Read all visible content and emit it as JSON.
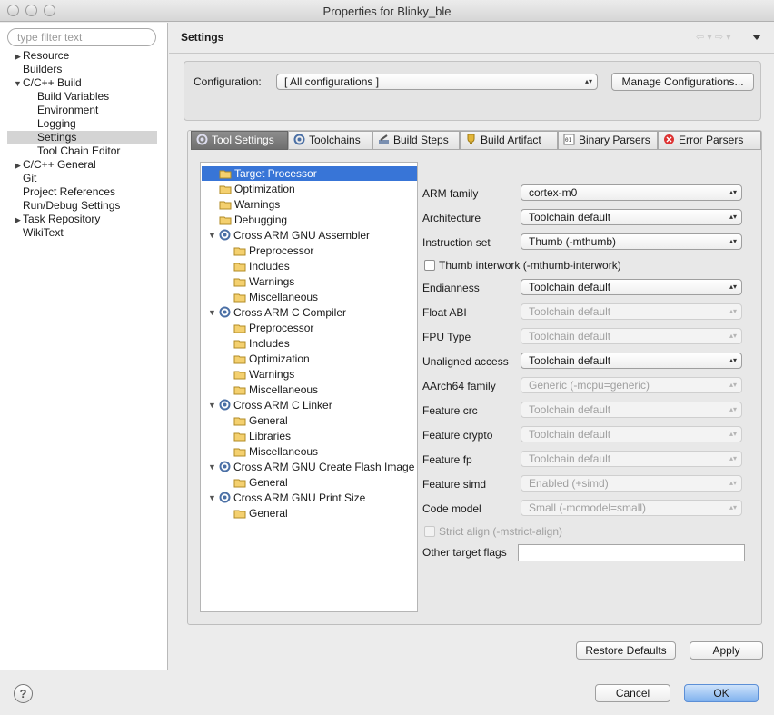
{
  "window": {
    "title": "Properties for Blinky_ble"
  },
  "filter": {
    "placeholder": "type filter text"
  },
  "nav": {
    "items": [
      {
        "label": "Resource"
      },
      {
        "label": "Builders"
      },
      {
        "label": "C/C++ Build"
      },
      {
        "label": "Build Variables"
      },
      {
        "label": "Environment"
      },
      {
        "label": "Logging"
      },
      {
        "label": "Settings"
      },
      {
        "label": "Tool Chain Editor"
      },
      {
        "label": "C/C++ General"
      },
      {
        "label": "Git"
      },
      {
        "label": "Project References"
      },
      {
        "label": "Run/Debug Settings"
      },
      {
        "label": "Task Repository"
      },
      {
        "label": "WikiText"
      }
    ]
  },
  "page": {
    "heading": "Settings",
    "nav_icons": "⇦ ▾  ⇨ ▾"
  },
  "config": {
    "label": "Configuration:",
    "value": "[ All configurations ]",
    "manage_label": "Manage Configurations..."
  },
  "tabs": [
    {
      "label": "Tool Settings",
      "icon": "tool-settings-icon"
    },
    {
      "label": "Toolchains",
      "icon": "toolchains-icon"
    },
    {
      "label": "Build Steps",
      "icon": "build-steps-icon"
    },
    {
      "label": "Build Artifact",
      "icon": "build-artifact-icon"
    },
    {
      "label": "Binary Parsers",
      "icon": "binary-parsers-icon"
    },
    {
      "label": "Error Parsers",
      "icon": "error-parsers-icon"
    }
  ],
  "tools": [
    {
      "label": "Target Processor"
    },
    {
      "label": "Optimization"
    },
    {
      "label": "Warnings"
    },
    {
      "label": "Debugging"
    },
    {
      "label": "Cross ARM GNU Assembler"
    },
    {
      "label": "Preprocessor"
    },
    {
      "label": "Includes"
    },
    {
      "label": "Warnings"
    },
    {
      "label": "Miscellaneous"
    },
    {
      "label": "Cross ARM C Compiler"
    },
    {
      "label": "Preprocessor"
    },
    {
      "label": "Includes"
    },
    {
      "label": "Optimization"
    },
    {
      "label": "Warnings"
    },
    {
      "label": "Miscellaneous"
    },
    {
      "label": "Cross ARM C Linker"
    },
    {
      "label": "General"
    },
    {
      "label": "Libraries"
    },
    {
      "label": "Miscellaneous"
    },
    {
      "label": "Cross ARM GNU Create Flash Image"
    },
    {
      "label": "General"
    },
    {
      "label": "Cross ARM GNU Print Size"
    },
    {
      "label": "General"
    }
  ],
  "props": [
    {
      "label": "ARM family",
      "value": "cortex-m0",
      "enabled": true
    },
    {
      "label": "Architecture",
      "value": "Toolchain default",
      "enabled": true
    },
    {
      "label": "Instruction set",
      "value": "Thumb (-mthumb)",
      "enabled": true
    },
    {
      "label": "Thumb interwork (-mthumb-interwork)",
      "checked": false,
      "enabled": true
    },
    {
      "label": "Endianness",
      "value": "Toolchain default",
      "enabled": true
    },
    {
      "label": "Float ABI",
      "value": "Toolchain default",
      "enabled": false
    },
    {
      "label": "FPU Type",
      "value": "Toolchain default",
      "enabled": false
    },
    {
      "label": "Unaligned access",
      "value": "Toolchain default",
      "enabled": true
    },
    {
      "label": "AArch64 family",
      "value": "Generic (-mcpu=generic)",
      "enabled": false
    },
    {
      "label": "Feature crc",
      "value": "Toolchain default",
      "enabled": false
    },
    {
      "label": "Feature crypto",
      "value": "Toolchain default",
      "enabled": false
    },
    {
      "label": "Feature fp",
      "value": "Toolchain default",
      "enabled": false
    },
    {
      "label": "Feature simd",
      "value": "Enabled (+simd)",
      "enabled": false
    },
    {
      "label": "Code model",
      "value": "Small (-mcmodel=small)",
      "enabled": false
    },
    {
      "label": "Strict align (-mstrict-align)",
      "checked": false,
      "enabled": false
    },
    {
      "label": "Other target flags",
      "value": ""
    }
  ],
  "actions": {
    "restore": "Restore Defaults",
    "apply": "Apply"
  },
  "dialog": {
    "help": "?",
    "cancel": "Cancel",
    "ok": "OK"
  }
}
